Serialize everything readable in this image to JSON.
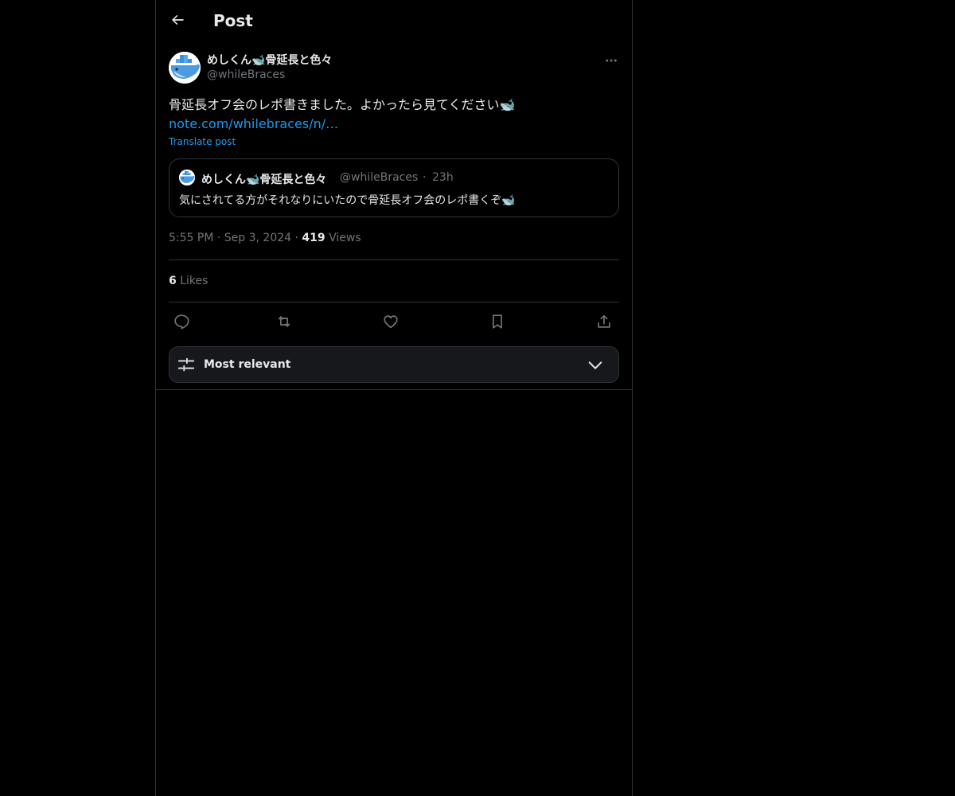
{
  "header": {
    "title": "Post",
    "back_icon": "arrow-left-icon"
  },
  "post": {
    "author_name": "めしくん🐋骨延長と色々",
    "author_handle": "@whileBraces",
    "text": "骨延長オフ会のレポ書きました。よかったら見てください🐋",
    "link": "note.com/whilebraces/n/…",
    "translate_label": "Translate post",
    "time": "5:55 PM",
    "date": "Sep 3, 2024",
    "views_count": "419",
    "views_label": "Views",
    "likes_count": "6",
    "likes_label": "Likes"
  },
  "quote": {
    "author_name": "めしくん🐋骨延長と色々",
    "author_handle": "@whileBraces",
    "separator": "·",
    "time": "23h",
    "text": "気にされてる方がそれなりにいたので骨延長オフ会のレポ書くぞ🐋"
  },
  "actions": [
    "reply-icon",
    "repost-icon",
    "like-icon",
    "bookmark-icon",
    "share-icon"
  ],
  "sort": {
    "label": "Most relevant"
  },
  "colors": {
    "accent": "#1d9bf0",
    "muted": "#71767b",
    "border": "#2f3336",
    "text": "#e7e9ea"
  }
}
